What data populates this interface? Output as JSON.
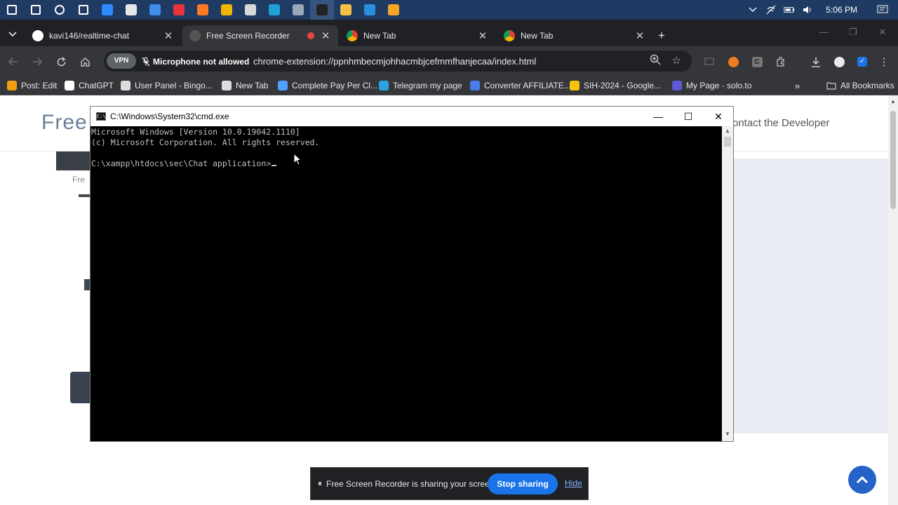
{
  "taskbar": {
    "icons": [
      {
        "name": "windows-start-icon",
        "color": "#ffffff"
      },
      {
        "name": "search-icon",
        "color": "#ffffff"
      },
      {
        "name": "cortana-icon",
        "color": "#ffffff"
      },
      {
        "name": "task-view-icon",
        "color": "#ffffff"
      },
      {
        "name": "shield-app-icon",
        "color": "#2e8bff"
      },
      {
        "name": "notepad-icon",
        "color": "#e8e8e8"
      },
      {
        "name": "mail-icon",
        "color": "#3f8de8"
      },
      {
        "name": "opera-icon",
        "color": "#e8343a"
      },
      {
        "name": "firefox-icon",
        "color": "#ff7a23"
      },
      {
        "name": "chrome-icon",
        "color": "#f1b400"
      },
      {
        "name": "store-icon",
        "color": "#d9d9d9"
      },
      {
        "name": "edge-icon",
        "color": "#1fa0d6"
      },
      {
        "name": "calculator-icon",
        "color": "#9aa6b8"
      },
      {
        "name": "cmd-taskbar-icon",
        "color": "#222222"
      },
      {
        "name": "file-explorer-icon",
        "color": "#f4c042"
      },
      {
        "name": "vscode-icon",
        "color": "#2b8fe0"
      },
      {
        "name": "chrome-canary-icon",
        "color": "#f6a623"
      }
    ],
    "clock": "5:06 PM"
  },
  "tabs": [
    {
      "title": "kavi146/realtime-chat",
      "favicon": "github",
      "active": false
    },
    {
      "title": "Free Screen Recorder",
      "favicon": "recorder",
      "active": true
    },
    {
      "title": "New Tab",
      "favicon": "chrome",
      "active": false
    },
    {
      "title": "New Tab",
      "favicon": "chrome",
      "active": false
    }
  ],
  "toolbar": {
    "vpn_label": "VPN",
    "mic_status": "Microphone not allowed",
    "url": "chrome-extension://ppnhmbecmjohhacmbjcefmmfhanjecaa/index.html"
  },
  "bookmarks": [
    {
      "label": "Post: Edit",
      "color": "#f39c12"
    },
    {
      "label": "ChatGPT",
      "color": "#ffffff"
    },
    {
      "label": "User Panel - Bingo...",
      "color": "#dddddd"
    },
    {
      "label": "New Tab",
      "color": "#dddddd"
    },
    {
      "label": "Complete Pay Per Cl...",
      "color": "#4ea1ff"
    },
    {
      "label": "Telegram my page",
      "color": "#2aa3e0"
    },
    {
      "label": "Converter AFFILIATE...",
      "color": "#4b7bec"
    },
    {
      "label": "SIH-2024 - Google...",
      "color": "#f4c20d"
    },
    {
      "label": "My Page · solo.to",
      "color": "#5b5bd6"
    }
  ],
  "all_bookmarks_label": "All Bookmarks",
  "page": {
    "brand": "Free",
    "contact": "ontact the Developer",
    "fre_fragment": "Fre"
  },
  "cmd": {
    "title": "C:\\Windows\\System32\\cmd.exe",
    "lines": [
      "Microsoft Windows [Version 10.0.19042.1110]",
      "(c) Microsoft Corporation. All rights reserved.",
      "",
      "C:\\xampp\\htdocs\\sec\\Chat application>"
    ]
  },
  "share_bar": {
    "message": "Free Screen Recorder is sharing your screen.",
    "stop_label": "Stop sharing",
    "hide_label": "Hide"
  },
  "colors": {
    "taskbar": "#1f3b63",
    "chrome_dark": "#202124",
    "chrome_toolbar": "#35363a",
    "accent_blue": "#1a73e8",
    "back_to_top": "#2563c9"
  }
}
